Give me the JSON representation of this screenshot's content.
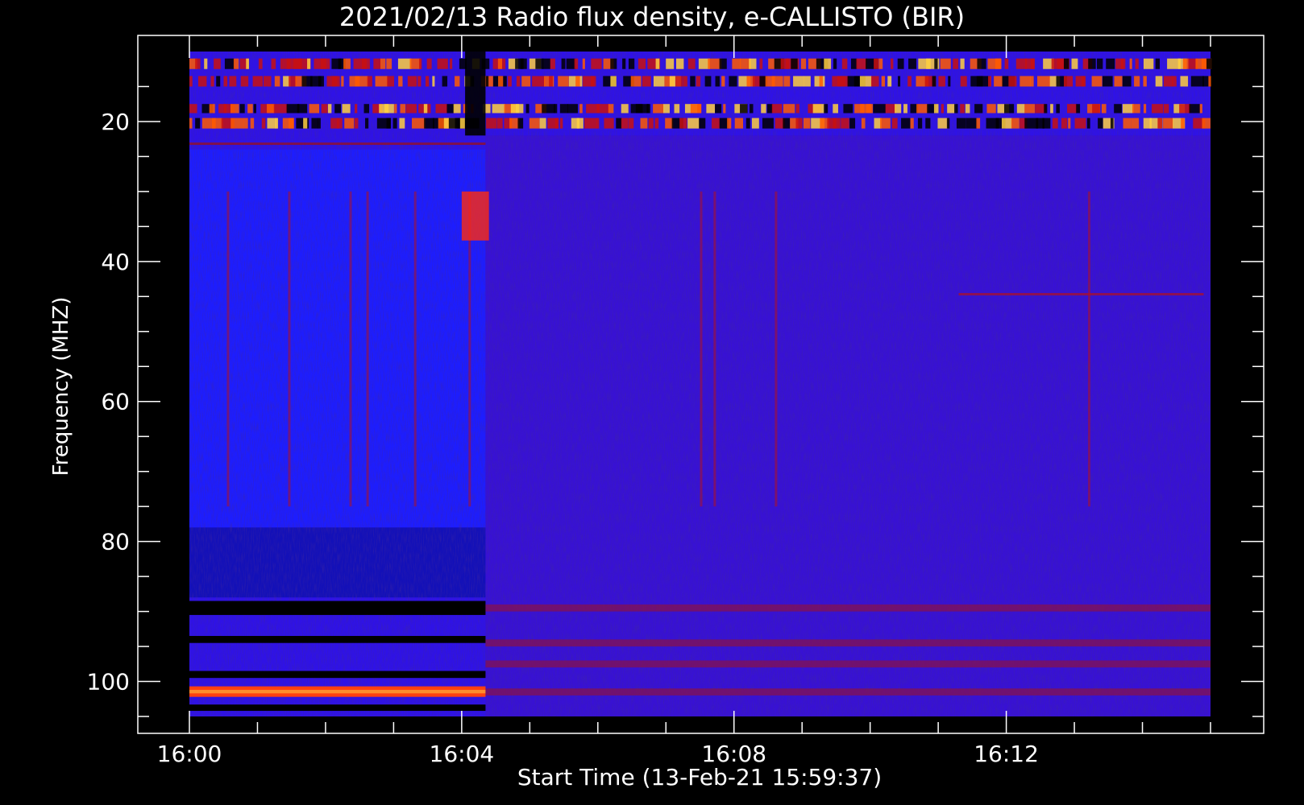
{
  "chart_data": {
    "type": "heatmap",
    "title": "2021/02/13  Radio flux density, e-CALLISTO (BIR)",
    "xlabel": "Start Time (13-Feb-21 15:59:37)",
    "ylabel": "Frequency (MHZ)",
    "x_ticks": [
      "16:00",
      "16:04",
      "16:08",
      "16:12"
    ],
    "y_ticks": [
      20,
      40,
      60,
      80,
      100
    ],
    "y_range": [
      10,
      105
    ],
    "y_inverted": true,
    "colormap": [
      "#000000",
      "#1a10ff",
      "#b01010",
      "#ff4000",
      "#ffd050"
    ],
    "x_data_range": [
      "16:00",
      "16:15"
    ]
  }
}
